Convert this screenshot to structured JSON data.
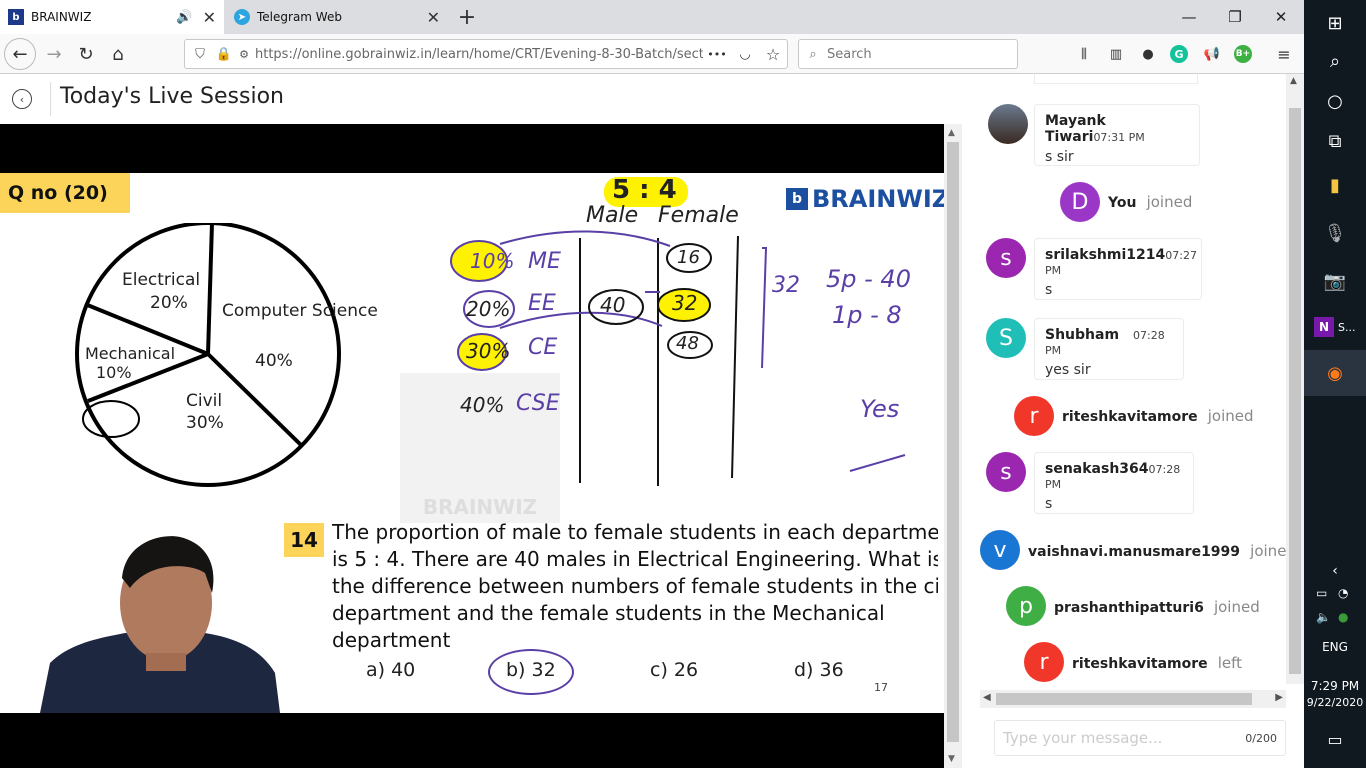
{
  "browser": {
    "tabs": [
      {
        "title": "BRAINWIZ"
      },
      {
        "title": "Telegram Web"
      }
    ],
    "url": "https://online.gobrainwiz.in/learn/home/CRT/Evening-8-30-Batch/sectio",
    "url_domain": "gobrainwiz.in",
    "search_placeholder": "Search",
    "more_glyph": "•••"
  },
  "page": {
    "title": "Today's Live Session"
  },
  "slide": {
    "qno": "Q no (20)",
    "logo": "BRAINWIZ",
    "watermark": "BRAINWIZ",
    "page_number": "17",
    "pie": [
      {
        "label": "Computer Science",
        "value": "40%"
      },
      {
        "label": "Electrical",
        "value": "20%"
      },
      {
        "label": "Mechanical",
        "value": "10%"
      },
      {
        "label": "Civil",
        "value": "30%"
      }
    ],
    "notes": {
      "ratio": "5 : 4",
      "male": "Male",
      "female": "Female",
      "rows": [
        {
          "pct": "10%",
          "dept": "ME",
          "val": "16"
        },
        {
          "pct": "20%",
          "dept": "EE",
          "male": "40",
          "val": "32"
        },
        {
          "pct": "30%",
          "dept": "CE",
          "val": "48"
        },
        {
          "pct": "40%",
          "dept": "CSE"
        }
      ],
      "diff": "32",
      "eq1": "5p - 40",
      "eq2": "1p - 8",
      "yes": "Yes"
    },
    "question": {
      "number": "14",
      "lines": [
        "The proportion of male to female students in each department",
        "is 5 : 4. There are 40 males in Electrical Engineering. What is",
        "the difference between numbers of female students in the civil",
        "department and the female students in the Mechanical",
        "department"
      ],
      "options": [
        "a) 40",
        "b) 32",
        "c) 26",
        "d) 36"
      ]
    }
  },
  "chat": {
    "messages": [
      {
        "type": "msg",
        "name": "Mayank Tiwari",
        "time": "07:31 PM",
        "text": "s sir",
        "avatar": "photo"
      },
      {
        "type": "join",
        "name": "You",
        "status": "joined",
        "initial": "D",
        "color": "#9b37c7"
      },
      {
        "type": "msg",
        "name": "srilakshmi1214",
        "time": "07:27 PM",
        "text": "s",
        "initial": "s",
        "color": "#9b27b0"
      },
      {
        "type": "msg",
        "name": "Shubham",
        "time": "07:28 PM",
        "text": "yes sir",
        "initial": "S",
        "color": "#1fbfb8"
      },
      {
        "type": "join",
        "name": "riteshkavitamore",
        "status": "joined",
        "initial": "r",
        "color": "#f0372a"
      },
      {
        "type": "msg",
        "name": "senakash364",
        "time": "07:28 PM",
        "text": "s",
        "initial": "s",
        "color": "#9b27b0"
      },
      {
        "type": "join",
        "name": "vaishnavi.manusmare1999",
        "status": "joined",
        "initial": "v",
        "color": "#1976d2"
      },
      {
        "type": "join",
        "name": "prashanthipatturi6",
        "status": "joined",
        "initial": "p",
        "color": "#3fae45"
      },
      {
        "type": "join",
        "name": "riteshkavitamore",
        "status": "left",
        "initial": "r",
        "color": "#f0372a"
      }
    ],
    "input_placeholder": "Type your message...",
    "char_count": "0/200"
  },
  "taskbar": {
    "onenote_label": "S...",
    "lang": "ENG",
    "time": "7:29 PM",
    "date": "9/22/2020"
  }
}
